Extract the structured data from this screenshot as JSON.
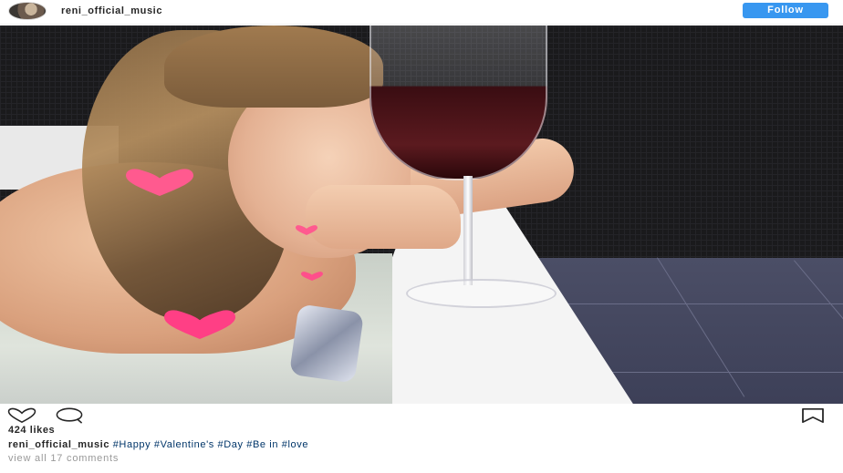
{
  "post": {
    "username": "reni_official_music",
    "follow_label": "Follow"
  },
  "photo": {
    "alt": ""
  },
  "actions": {
    "like_icon": "heart-outline-icon",
    "comment_icon": "speech-bubble-icon",
    "save_icon": "bookmark-icon"
  },
  "likes_text": "424 likes",
  "caption": {
    "username": "reni_official_music",
    "parts": [
      {
        "text": "#Happy",
        "type": "hashtag"
      },
      {
        "text": " ",
        "type": "plain"
      },
      {
        "text": "#Valentine",
        "type": "hashtag"
      },
      {
        "text": "'s ",
        "type": "hashtag"
      },
      {
        "text": "#Day",
        "type": "hashtag"
      },
      {
        "text": " ",
        "type": "plain"
      },
      {
        "text": "#Be",
        "type": "hashtag"
      },
      {
        "text": " in ",
        "type": "hashtag"
      },
      {
        "text": "#love",
        "type": "hashtag"
      }
    ]
  },
  "view_comments": "view all 17 comments",
  "colors": {
    "follow_button": "#3897f0",
    "hashtag": "#003569",
    "muted": "#999999",
    "sticker_heart": "#ff4f8b"
  }
}
